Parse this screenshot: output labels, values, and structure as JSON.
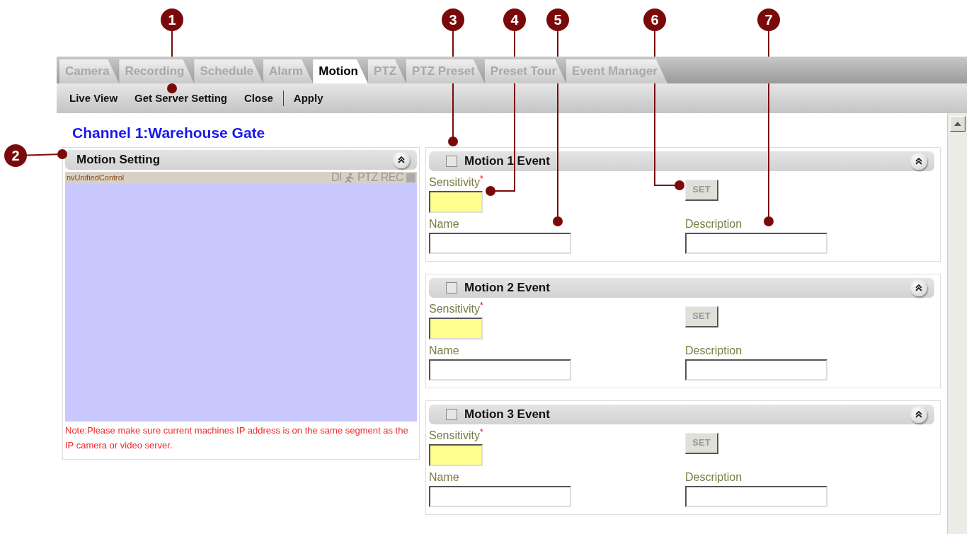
{
  "callouts": [
    {
      "label": "1"
    },
    {
      "label": "2"
    },
    {
      "label": "3"
    },
    {
      "label": "4"
    },
    {
      "label": "5"
    },
    {
      "label": "6"
    },
    {
      "label": "7"
    }
  ],
  "tabs": [
    {
      "label": "Camera",
      "selected": false
    },
    {
      "label": "Recording",
      "selected": false
    },
    {
      "label": "Schedule",
      "selected": false
    },
    {
      "label": "Alarm",
      "selected": false
    },
    {
      "label": "Motion",
      "selected": true
    },
    {
      "label": "PTZ",
      "selected": false
    },
    {
      "label": "PTZ Preset",
      "selected": false
    },
    {
      "label": "Preset Tour",
      "selected": false
    },
    {
      "label": "Event Manager",
      "selected": false
    }
  ],
  "toolbar": [
    {
      "label": "Live View",
      "separator_before": false
    },
    {
      "label": "Get Server Setting",
      "separator_before": false
    },
    {
      "label": "Close",
      "separator_before": false
    },
    {
      "label": "Apply",
      "separator_before": true
    }
  ],
  "channel_title": "Channel 1:Warehouse Gate",
  "motion_setting": {
    "title": "Motion Setting",
    "control_name": "nvUnifiedControl",
    "indicators": [
      {
        "kind": "text",
        "text": "DI"
      },
      {
        "kind": "icon"
      },
      {
        "kind": "text",
        "text": "PTZ"
      },
      {
        "kind": "text",
        "text": "REC"
      },
      {
        "kind": "square"
      }
    ],
    "note": "Note:Please make sure current machines IP address is on the same segment as the IP camera or video server."
  },
  "events": [
    {
      "title": "Motion 1 Event",
      "checked": false,
      "sensitivity_label": "Sensitivity",
      "required_mark": "*",
      "set_button": "SET",
      "name_label": "Name",
      "description_label": "Description"
    },
    {
      "title": "Motion 2 Event",
      "checked": false,
      "sensitivity_label": "Sensitivity",
      "required_mark": "*",
      "set_button": "SET",
      "name_label": "Name",
      "description_label": "Description"
    },
    {
      "title": "Motion 3 Event",
      "checked": false,
      "sensitivity_label": "Sensitivity",
      "required_mark": "*",
      "set_button": "SET",
      "name_label": "Name",
      "description_label": "Description"
    }
  ]
}
